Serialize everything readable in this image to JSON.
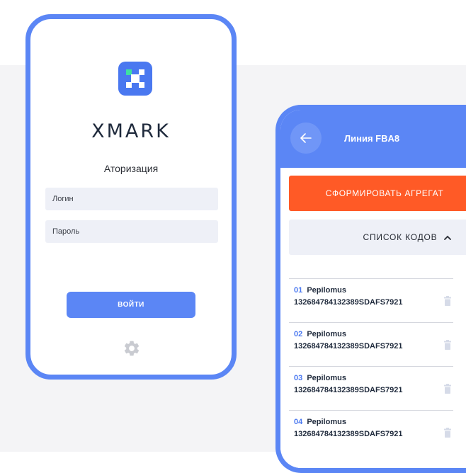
{
  "login_screen": {
    "brand": "XMARK",
    "title": "Аторизация",
    "login_placeholder": "Логин",
    "password_placeholder": "Пароль",
    "submit_label": "ВОЙТИ",
    "icons": {
      "logo": "xmark-logo-icon",
      "settings": "gear-icon"
    },
    "colors": {
      "accent": "#5b86f5",
      "logo_green": "#3ee0a3"
    }
  },
  "line_screen": {
    "title": "Линия FBA8",
    "form_aggregate_label": "СФОРМИРОВАТЬ АГРЕГАТ",
    "codes_list_label": "СПИСОК КОДОВ",
    "icons": {
      "back": "arrow-left-icon",
      "toggle": "chevron-up-icon",
      "delete": "trash-icon"
    },
    "colors": {
      "header": "#5b86f5",
      "primary_action": "#ff5a26"
    },
    "items": [
      {
        "num": "01",
        "name": "Pepilomus",
        "code": "132684784132389SDAFS7921"
      },
      {
        "num": "02",
        "name": "Pepilomus",
        "code": "132684784132389SDAFS7921"
      },
      {
        "num": "03",
        "name": "Pepilomus",
        "code": "132684784132389SDAFS7921"
      },
      {
        "num": "04",
        "name": "Pepilomus",
        "code": "132684784132389SDAFS7921"
      }
    ]
  }
}
